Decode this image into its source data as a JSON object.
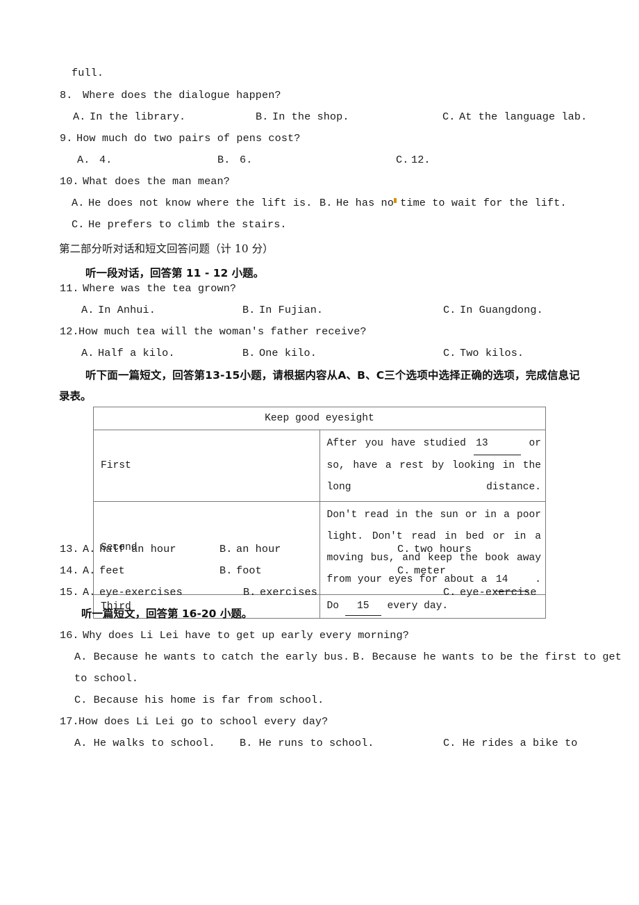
{
  "document": {
    "language": "zh-CN / en",
    "type": "listening-comprehension-exam-page"
  },
  "continuation_line": "full.",
  "section_one_questions": [
    {
      "number": "8.",
      "stem": "Where does the dialogue happen?",
      "options": [
        {
          "letter": "A.",
          "text": "In the library."
        },
        {
          "letter": "B.",
          "text": "In the shop."
        },
        {
          "letter": "C.",
          "text": "At the language lab."
        }
      ]
    },
    {
      "number": "9.",
      "stem": "How much do two pairs of pens cost?",
      "options": [
        {
          "letter": "A.",
          "text": "4."
        },
        {
          "letter": "B.",
          "text": "6."
        },
        {
          "letter": "C.",
          "text": "12."
        }
      ]
    },
    {
      "number": "10.",
      "stem": "What does the man mean?",
      "options": [
        {
          "letter": "A.",
          "text": "He does not know where the lift is."
        },
        {
          "letter": "B.",
          "text": "He has no time to wait for the lift."
        },
        {
          "letter": "C.",
          "text": "He prefers to climb the stairs."
        }
      ]
    }
  ],
  "part_two": {
    "heading": "第二部分听对话和短文回答问题（计 10 分）",
    "instruction_11_12": "听一段对话，回答第 11 - 12 小题。",
    "instruction_13_15_line1": "听下面一篇短文，回答第13-15小题，请根据内容从A、B、C三个选项中选择正确的选项，完成信息记",
    "instruction_13_15_line2": "录表。",
    "instruction_16_20": "听一篇短文，回答第 16-20 小题。"
  },
  "questions_11_12": [
    {
      "number": "11.",
      "stem": "Where was the tea grown?",
      "options": [
        {
          "letter": "A.",
          "text": "In Anhui."
        },
        {
          "letter": "B.",
          "text": "In Fujian."
        },
        {
          "letter": "C.",
          "text": "In Guangdong."
        }
      ]
    },
    {
      "number": "12.",
      "stem": "How much tea will the woman's father receive?",
      "options": [
        {
          "letter": "A.",
          "text": "Half a kilo."
        },
        {
          "letter": "B.",
          "text": "One kilo."
        },
        {
          "letter": "C.",
          "text": "Two kilos."
        }
      ]
    }
  ],
  "eyesight_table": {
    "title": "Keep good eyesight",
    "rows": [
      {
        "label": "First",
        "text_before_blank": "After you have studied ",
        "blank": "13",
        "text_after_blank": " or so, have a rest by looking in the long distance."
      },
      {
        "label": "Second",
        "text_before_blank": "Don't read in the sun or in a poor light. Don't read in bed or in a moving bus,  and keep the book away from your eyes for about a ",
        "blank": "14",
        "text_after_blank": " ."
      },
      {
        "label": "Third",
        "text_before_blank": "Do ",
        "blank": "15",
        "text_after_blank": " every day."
      }
    ]
  },
  "questions_13_15": [
    {
      "number": "13.",
      "options": [
        {
          "letter": "A.",
          "text": "half an hour"
        },
        {
          "letter": "B.",
          "text": "an hour"
        },
        {
          "letter": "C.",
          "text": "two hours"
        }
      ]
    },
    {
      "number": "14.",
      "options": [
        {
          "letter": "A.",
          "text": "feet"
        },
        {
          "letter": "B.",
          "text": "foot"
        },
        {
          "letter": "C.",
          "text": "meter"
        }
      ]
    },
    {
      "number": "15.",
      "options": [
        {
          "letter": "A.",
          "text": "eye-exercises"
        },
        {
          "letter": "B.",
          "text": "exercises"
        },
        {
          "letter": "C.",
          "text": "eye-exercise"
        }
      ]
    }
  ],
  "questions_16_17": [
    {
      "number": "16.",
      "stem": "Why does Li Lei have to get up early every morning?",
      "option_a": "A. Because he wants to catch the early bus.",
      "option_b_line1": "B. Because he wants to be the first to get",
      "option_b_line2": "to school.",
      "option_c": "C. Because his home is far from school."
    },
    {
      "number": "17.",
      "stem": "How does Li Lei go to school every day?",
      "option_a": "A. He walks to school.",
      "option_b": "B. He runs to school.",
      "option_c": "C. He rides a bike to"
    }
  ],
  "colors": {
    "text": "#1a1a1a",
    "table_border": "#7a7a7a",
    "caret_artifact": "#d89000",
    "page_background": "#ffffff"
  }
}
